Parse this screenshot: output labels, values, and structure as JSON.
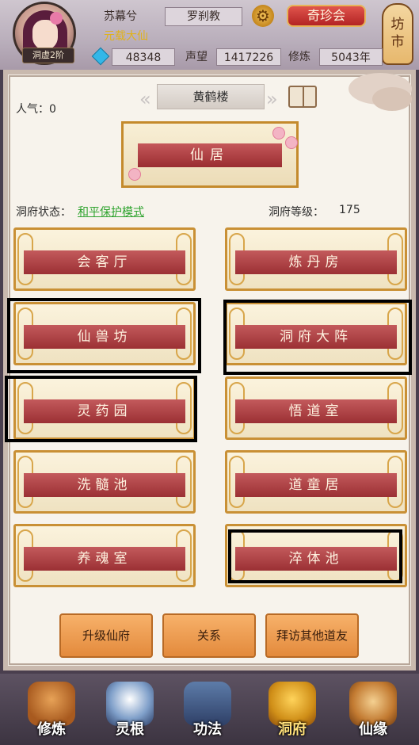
{
  "player": {
    "name": "苏幕兮",
    "title": "元载大仙",
    "rank": "洞虚2阶",
    "sect": "罗刹教",
    "spirit_stones": "48348",
    "reputation_label": "声望",
    "reputation": "1417226",
    "cultivation_label": "修炼",
    "cultivation": "5043年"
  },
  "header": {
    "treasure_label": "奇珍会",
    "market_label": "坊\n市"
  },
  "cave": {
    "popularity": "人气：0",
    "location": "黄鹤楼",
    "main_room": "仙居",
    "status_label": "洞府状态：",
    "status_value": "和平保护模式",
    "level_label": "洞府等级：",
    "level_value": "175",
    "rooms": [
      {
        "label": "会客厅"
      },
      {
        "label": "炼丹房"
      },
      {
        "label": "仙兽坊"
      },
      {
        "label": "洞府大阵"
      },
      {
        "label": "灵药园"
      },
      {
        "label": "悟道室"
      },
      {
        "label": "洗髓池"
      },
      {
        "label": "道童居"
      },
      {
        "label": "养魂室"
      },
      {
        "label": "淬体池"
      }
    ]
  },
  "actions": {
    "upgrade": "升级仙府",
    "relations": "关系",
    "visit": "拜访其他道友"
  },
  "nav": [
    {
      "label": "修炼"
    },
    {
      "label": "灵根"
    },
    {
      "label": "功法"
    },
    {
      "label": "洞府"
    },
    {
      "label": "仙缘"
    }
  ],
  "colors": {
    "accent_red": "#9b3034",
    "status_green": "#2ea32e",
    "title_gold": "#e0b21c"
  }
}
